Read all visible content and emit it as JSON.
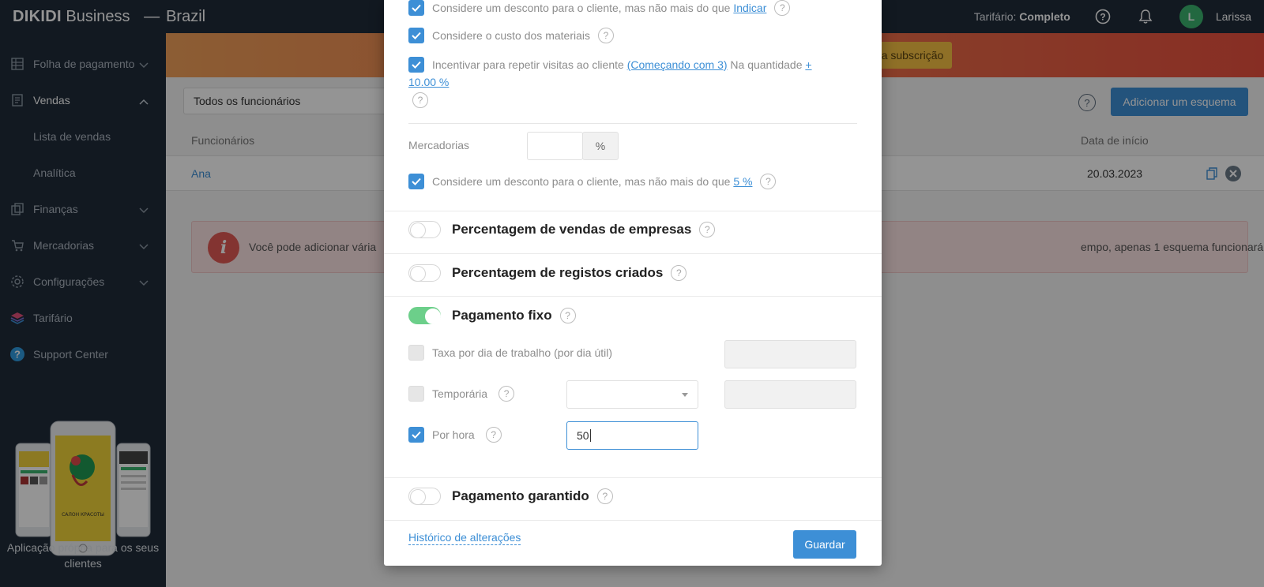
{
  "topbar": {
    "brand": "DIKIDI",
    "brand_suffix": "Business",
    "separator": "—",
    "region": "Brazil",
    "tariff_label": "Tarifário:",
    "tariff_value": "Completo",
    "avatar_letter": "L",
    "username": "Larissa"
  },
  "sidebar": {
    "items": [
      {
        "label": "Folha de pagamento",
        "icon": "payroll-icon"
      },
      {
        "label": "Vendas",
        "icon": "sales-icon"
      },
      {
        "label": "Lista de vendas"
      },
      {
        "label": "Analítica"
      },
      {
        "label": "Finanças",
        "icon": "finance-icon"
      },
      {
        "label": "Mercadorias",
        "icon": "goods-icon"
      },
      {
        "label": "Configurações",
        "icon": "gear-icon"
      },
      {
        "label": "Tarifário",
        "icon": "layers-icon"
      },
      {
        "label": "Support Center",
        "icon": "help-icon"
      }
    ],
    "promo_text": "Aplicação própria para os seus clientes",
    "phone_caption": "САЛОН КРАСОТЫ"
  },
  "main": {
    "banner_button": "a subscrição",
    "filter_value": "Todos os funcionários",
    "add_button": "Adicionar um esquema",
    "columns": [
      "Funcionários",
      "Data de início"
    ],
    "rows": [
      {
        "employee": "Ana",
        "start_date": "20.03.2023"
      }
    ],
    "alert_text_left": "Você pode adicionar vária",
    "alert_text_right": "empo, apenas 1 esquema funcionará."
  },
  "modal": {
    "services_discount": {
      "label": "Considere um desconto para o cliente, mas não mais do que",
      "link": "Indicar"
    },
    "materials": {
      "label": "Considere o custo dos materiais"
    },
    "repeat_visits": {
      "label": "Incentivar para repetir visitas ao cliente",
      "link1": "(Começando com 3)",
      "middle": "Na quantidade",
      "link2_a": "+",
      "link2_b": "10.00 %"
    },
    "goods_label": "Mercadorias",
    "goods_unit": "%",
    "goods_discount": {
      "label": "Considere um desconto para o cliente, mas não mais do que",
      "link": "5 %"
    },
    "sections": {
      "company_sales": "Percentagem de vendas de empresas",
      "records_created": "Percentagem de registos criados",
      "fixed_payment": "Pagamento fixo",
      "guaranteed_payment": "Pagamento garantido"
    },
    "fixed": {
      "rate_per_day": "Taxa por dia de trabalho (por dia útil)",
      "temporary": "Temporária",
      "per_hour": "Por hora",
      "per_hour_value": "50"
    },
    "history_link": "Histórico de alterações",
    "save_button": "Guardar"
  },
  "colors": {
    "sidebar_bg": "#1f2b3a",
    "accent": "#3d8fd6",
    "toggle_on": "#6ccf8a",
    "avatar": "#3bb46f"
  }
}
